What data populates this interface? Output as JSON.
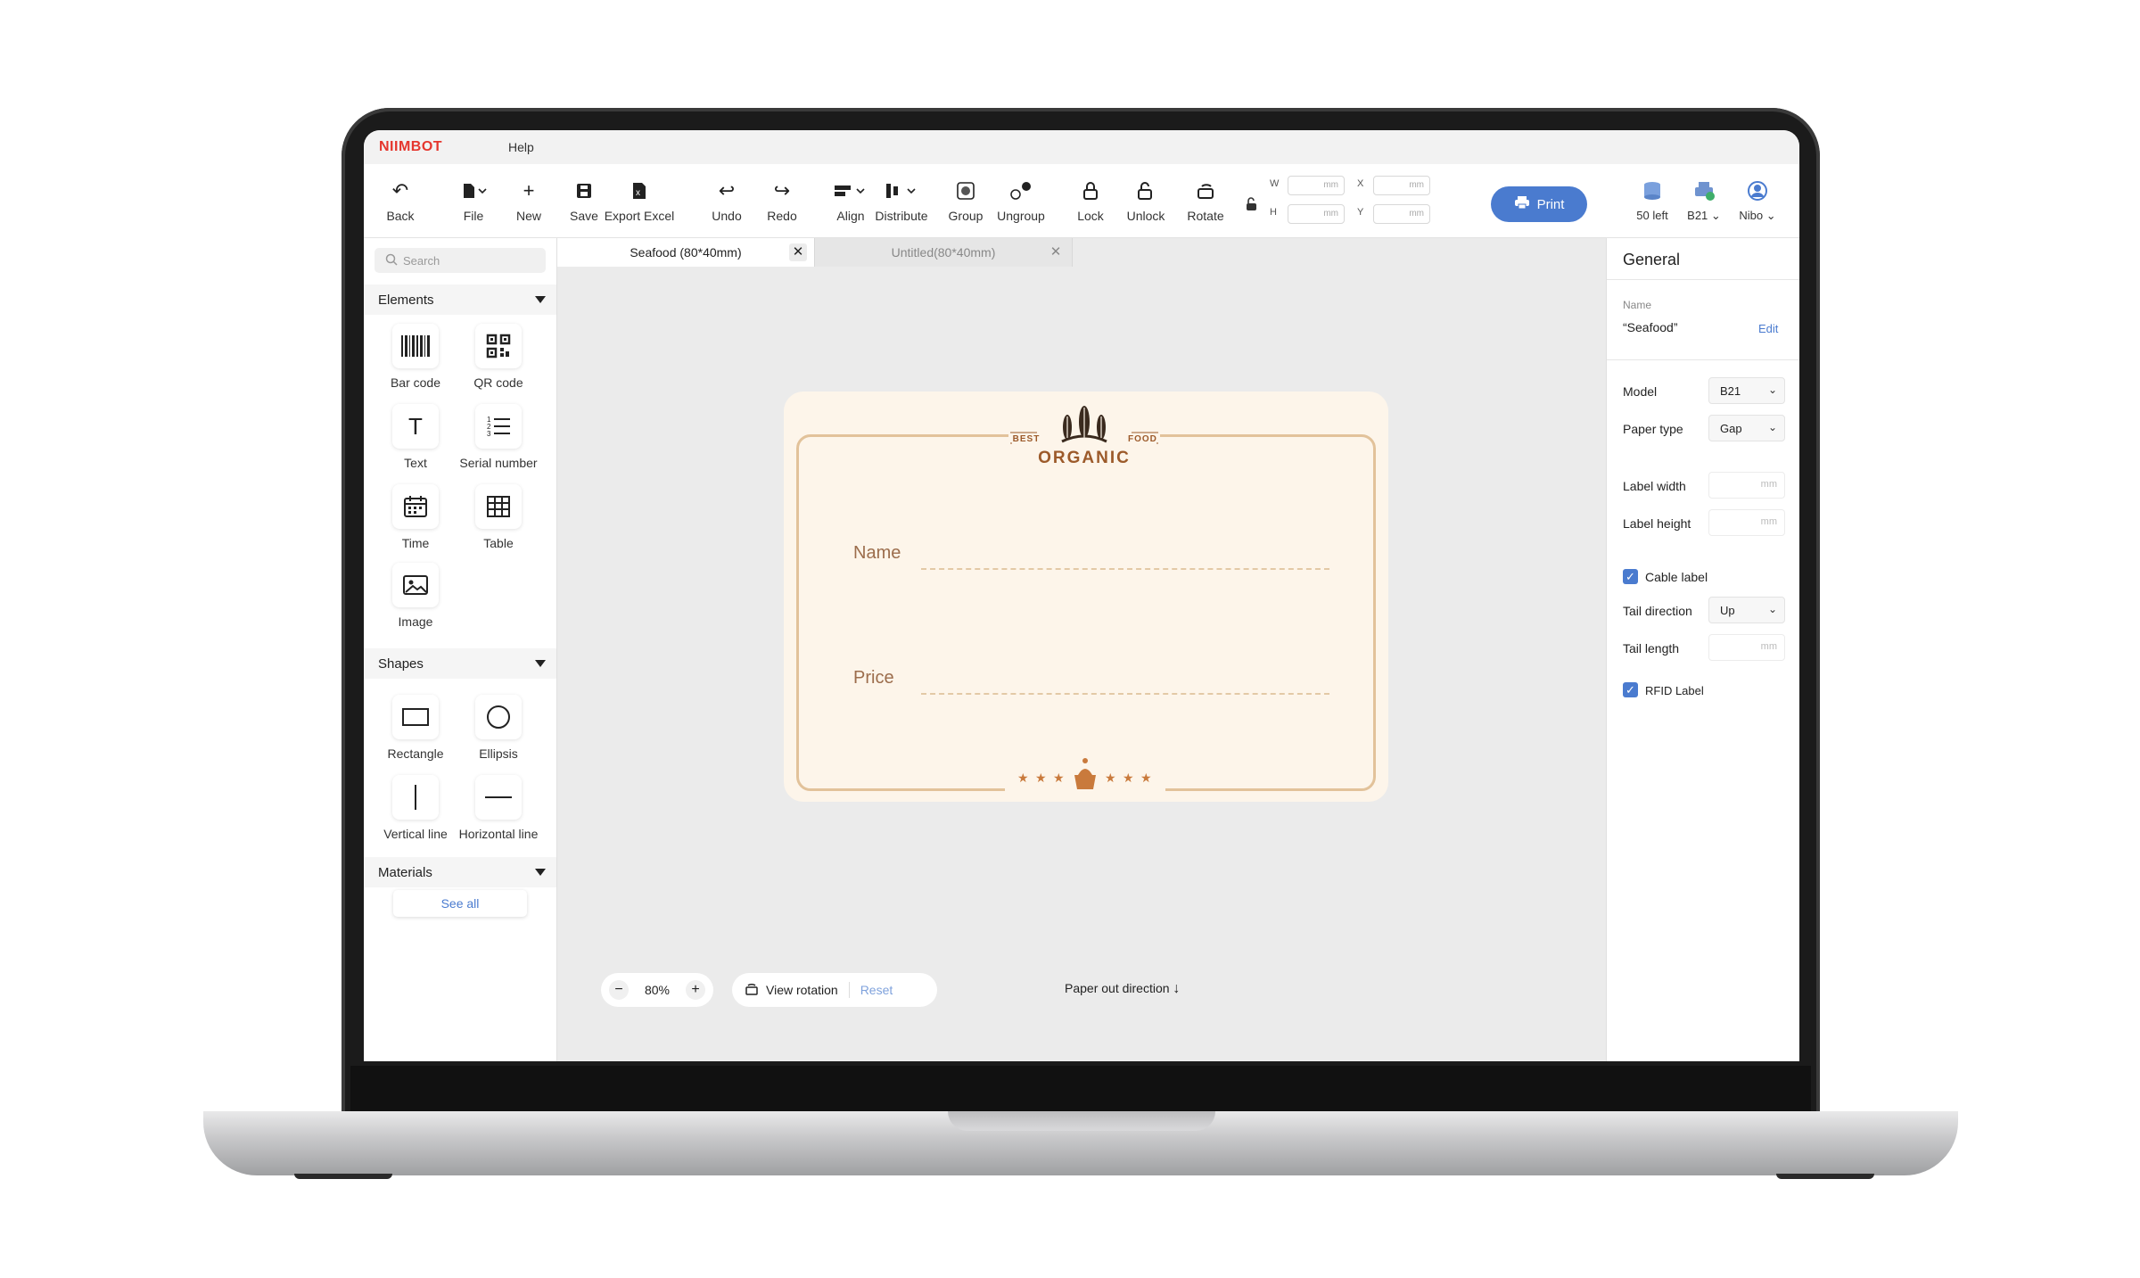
{
  "app": {
    "logo": "NIIMBOT",
    "menu_help": "Help"
  },
  "toolbar": {
    "back": "Back",
    "file": "File",
    "new": "New",
    "save": "Save",
    "export_excel": "Export Excel",
    "undo": "Undo",
    "redo": "Redo",
    "align": "Align",
    "distribute": "Distribute",
    "group": "Group",
    "ungroup": "Ungroup",
    "lock": "Lock",
    "unlock": "Unlock",
    "rotate": "Rotate",
    "w_label": "W",
    "h_label": "H",
    "x_label": "X",
    "y_label": "Y",
    "unit": "mm",
    "print": "Print",
    "paper_left": "50 left",
    "printer_model": "B21",
    "user": "Nibo"
  },
  "sidebar": {
    "search_placeholder": "Search",
    "elements_header": "Elements",
    "elements": [
      "Bar code",
      "QR code",
      "Text",
      "Serial number",
      "Time",
      "Table",
      "Image"
    ],
    "shapes_header": "Shapes",
    "shapes": [
      "Rectangle",
      "Ellipsis",
      "Vertical line",
      "Horizontal line"
    ],
    "materials_header": "Materials",
    "see_all": "See all"
  },
  "tabs": [
    {
      "label": "Seafood (80*40mm)",
      "active": true
    },
    {
      "label": "Untitled(80*40mm)",
      "active": false
    }
  ],
  "label_design": {
    "best": "BEST",
    "food": "FOOD",
    "organic": "ORGANIC",
    "field1": "Name",
    "field2": "Price"
  },
  "bottom": {
    "zoom": "80%",
    "view_rotation": "View rotation",
    "reset": "Reset",
    "paper_out": "Paper out direction"
  },
  "panel": {
    "title": "General",
    "name_label": "Name",
    "name_value": "“Seafood”",
    "edit": "Edit",
    "model_label": "Model",
    "model_value": "B21",
    "paper_type_label": "Paper type",
    "paper_type_value": "Gap",
    "label_width": "Label width",
    "label_height": "Label height",
    "unit": "mm",
    "cable_label": "Cable label",
    "tail_direction": "Tail direction",
    "tail_direction_value": "Up",
    "tail_length": "Tail length",
    "rfid_label": "RFID Label"
  },
  "colors": {
    "accent": "#4a7bcf",
    "brand": "#e5362d",
    "label_bg": "#fdf5ea",
    "label_border": "#e2c29a"
  }
}
